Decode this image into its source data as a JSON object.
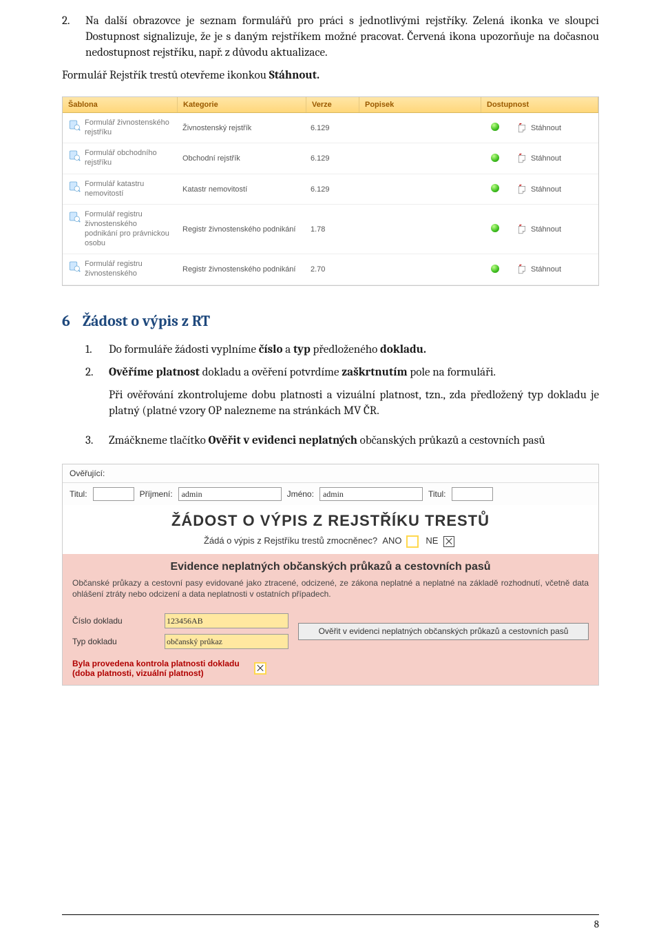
{
  "para1_num": "2.",
  "para1_a": "Na další obrazovce je seznam formulářů pro práci s jednotlivými rejstříky. Zelená ikonka ve sloupci Dostupnost signalizuje, že je s daným rejstříkem možné pracovat. Červená ikona upozorňuje na dočasnou nedostupnost rejstříku, např. z důvodu aktualizace.",
  "para1_b_pre": "Formulář Rejstřík trestů otevřeme ikonkou ",
  "para1_b_bold": "Stáhnout.",
  "table": {
    "headers": {
      "sablona": "Šablona",
      "kategorie": "Kategorie",
      "verze": "Verze",
      "popisek": "Popisek",
      "dostupnost": "Dostupnost"
    },
    "dl_label": "Stáhnout",
    "rows": [
      {
        "sablona": "Formulář živnostenského rejstříku",
        "kategorie": "Živnostenský rejstřík",
        "verze": "6.129"
      },
      {
        "sablona": "Formulář obchodního rejstříku",
        "kategorie": "Obchodní rejstřík",
        "verze": "6.129"
      },
      {
        "sablona": "Formulář katastru nemovitostí",
        "kategorie": "Katastr nemovitostí",
        "verze": "6.129"
      },
      {
        "sablona": "Formulář registru živnostenského podnikání pro právnickou osobu",
        "kategorie": "Registr živnostenského podnikání",
        "verze": "1.78"
      },
      {
        "sablona": "Formulář registru živnostenského",
        "kategorie": "Registr živnostenského podnikání",
        "verze": "2.70"
      }
    ]
  },
  "sec6_num": "6",
  "sec6_title": "Žádost o výpis z RT",
  "step1_num": "1.",
  "step1_a": "Do formuláře žádosti vyplníme ",
  "step1_b1": "číslo",
  "step1_mid": " a ",
  "step1_b2": "typ",
  "step1_c": " předloženého ",
  "step1_b3": "dokladu.",
  "step2_num": "2.",
  "step2_a": "Ověříme platnost",
  "step2_b": " dokladu a ověření potvrdíme ",
  "step2_c": "zaškrtnutím",
  "step2_d": " pole na formuláři.",
  "step2_p2": "Při ověřování zkontrolujeme dobu platnosti a vizuální platnost, tzn., zda předložený typ dokladu je platný (platné vzory OP nalezneme na stránkách  MV ČR.",
  "step3_num": "3.",
  "step3_a": "Zmáčkneme tlačítko ",
  "step3_b": "Ověřit v evidenci neplatných",
  "step3_c": " občanských průkazů a cestovních pasů",
  "form": {
    "overujici_lbl": "Ověřující:",
    "titul_lbl": "Titul:",
    "prijmeni_lbl": "Příjmení:",
    "prijmeni_val": "admin",
    "jmeno_lbl": "Jméno:",
    "jmeno_val": "admin",
    "titul2_lbl": "Titul:",
    "title": "ŽÁDOST O VÝPIS Z REJSTŘÍKU TRESTŮ",
    "subq": "Žádá o výpis z Rejstříku trestů zmocněnec?",
    "ano": "ANO",
    "ne": "NE",
    "evidence_hdr": "Evidence neplatných občanských průkazů a cestovních pasů",
    "evidence_desc": "Občanské průkazy a cestovní pasy evidované jako ztracené, odcizené, ze zákona neplatné a neplatné na základě rozhodnutí, včetně data ohlášení ztráty nebo odcizení a data neplatnosti v ostatních případech.",
    "cislo_lbl": "Číslo dokladu",
    "cislo_val": "123456AB",
    "typ_lbl": "Typ dokladu",
    "typ_val": "občanský průkaz",
    "btn": "Ověřit v evidenci neplatných občanských průkazů a cestovních pasů",
    "red1": "Byla provedena kontrola platnosti dokladu",
    "red2": "(doba platnosti, vizuální platnost)"
  },
  "page_num": "8"
}
